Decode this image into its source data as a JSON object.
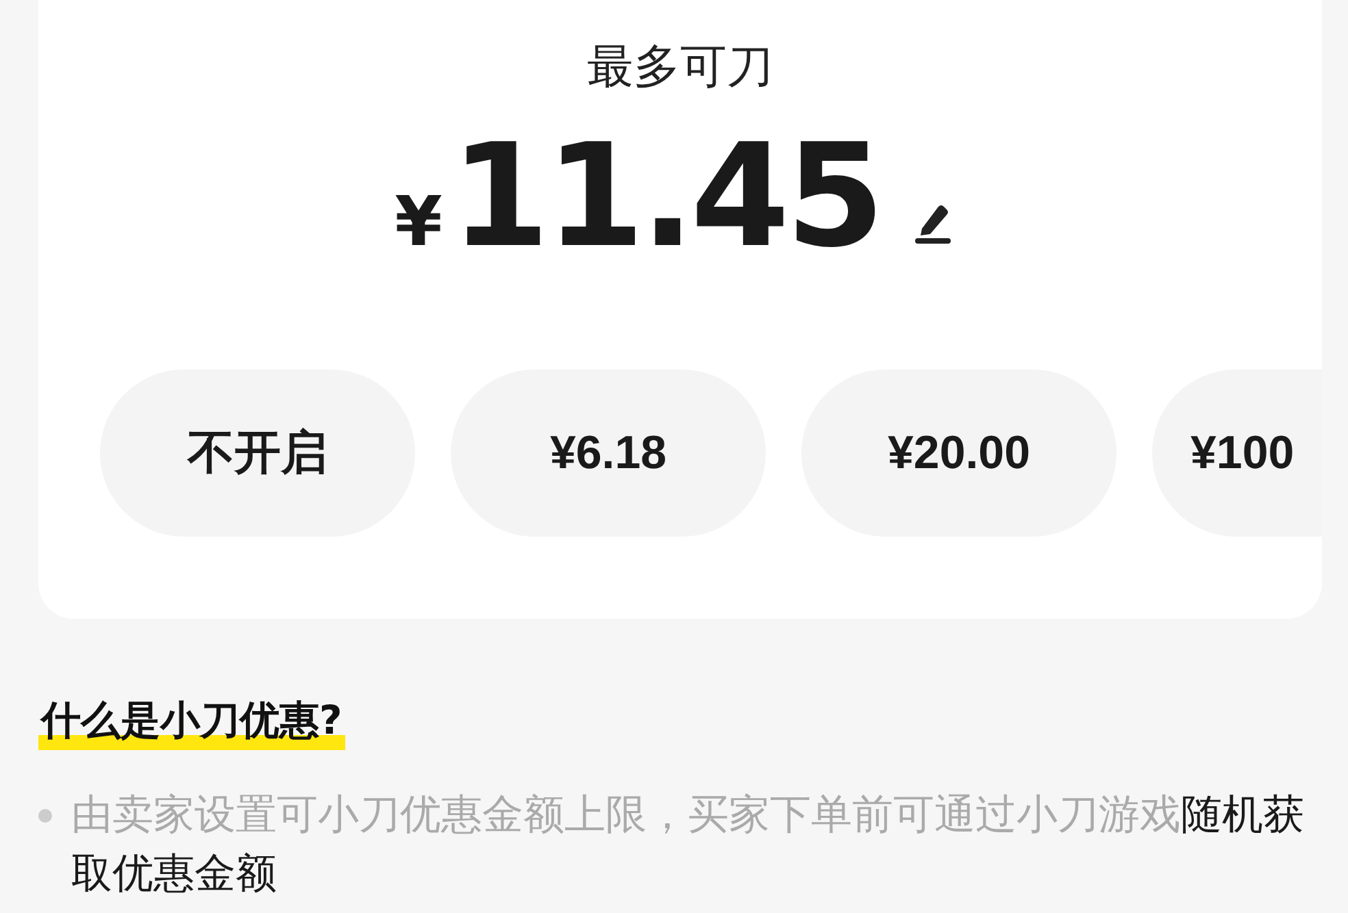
{
  "limit_card": {
    "title": "最多可刀",
    "currency": "¥",
    "amount": "11.45",
    "options": [
      {
        "label": "不开启",
        "selected": false
      },
      {
        "label": "¥6.18",
        "selected": false
      },
      {
        "label": "¥20.00",
        "selected": false
      },
      {
        "label": "¥100",
        "selected": false
      }
    ]
  },
  "faq": {
    "heading": "什么是小刀优惠?",
    "bullets": [
      "由卖家设置可小刀优惠金额上限，买家下单前可通过小刀游戏**随机获取优惠金额**"
    ]
  }
}
